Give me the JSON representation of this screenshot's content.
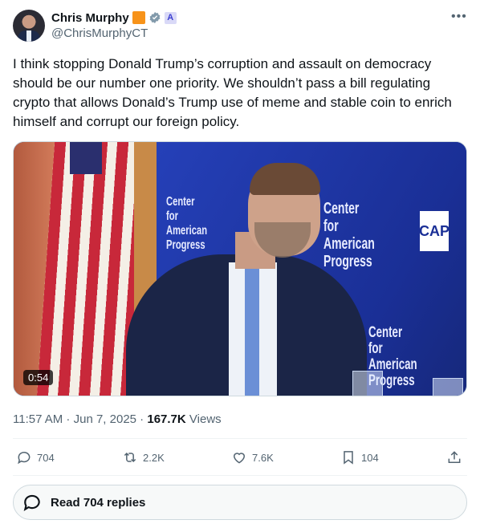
{
  "author": {
    "name": "Chris Murphy",
    "handle": "@ChrisMurphyCT",
    "gov_badge_glyph": "A"
  },
  "tweet": {
    "text": "I think stopping Donald Trump’s corruption and assault on democracy should be our number one priority. We shouldn’t pass a bill regulating crypto that allows Donald’s Trump use of meme and stable coin to enrich himself and corrupt our foreign policy."
  },
  "media": {
    "duration": "0:54",
    "wall_text_1": "Center for American Progress",
    "wall_text_2": "Center for American Progress",
    "wall_text_3": "Center for American Progress",
    "cap_label": "CAP"
  },
  "meta": {
    "time": "11:57 AM",
    "date": "Jun 7, 2025",
    "views_count": "167.7K",
    "views_label": "Views",
    "sep": " · "
  },
  "actions": {
    "replies": "704",
    "reposts": "2.2K",
    "likes": "7.6K",
    "bookmarks": "104"
  },
  "read_replies": {
    "label": "Read 704 replies"
  },
  "colors": {
    "accent_badge": "#f7931a",
    "verified_badge": "#829aab",
    "text_secondary": "#536471"
  },
  "icons": [
    "more-icon",
    "verified-icon",
    "reply-icon",
    "repost-icon",
    "like-icon",
    "bookmark-icon",
    "share-icon",
    "speech-bubble-icon"
  ]
}
